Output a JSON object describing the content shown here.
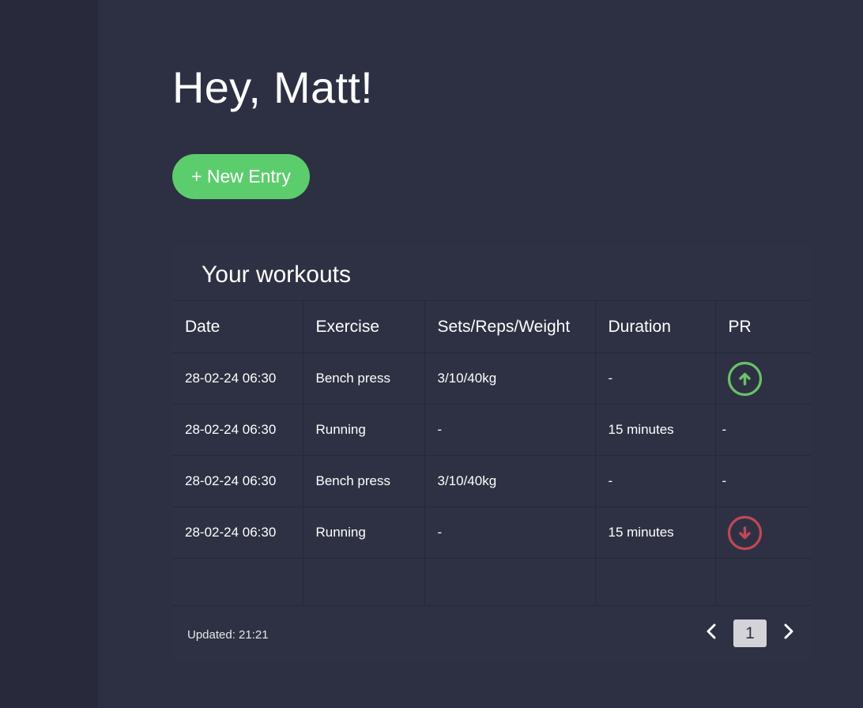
{
  "greeting": "Hey, Matt!",
  "new_entry_label": "+ New Entry",
  "workouts": {
    "title": "Your workouts",
    "columns": [
      "Date",
      "Exercise",
      "Sets/Reps/Weight",
      "Duration",
      "PR"
    ],
    "rows": [
      {
        "date": "28-02-24 06:30",
        "exercise": "Bench press",
        "srw": "3/10/40kg",
        "duration": "-",
        "pr": "up-icon"
      },
      {
        "date": "28-02-24 06:30",
        "exercise": "Running",
        "srw": "-",
        "duration": "15 minutes",
        "pr": "-"
      },
      {
        "date": "28-02-24 06:30",
        "exercise": "Bench press",
        "srw": "3/10/40kg",
        "duration": "-",
        "pr": "-"
      },
      {
        "date": "28-02-24 06:30",
        "exercise": "Running",
        "srw": "-",
        "duration": "15 minutes",
        "pr": "down-icon"
      }
    ],
    "updated": "Updated: 21:21",
    "page": "1"
  },
  "colors": {
    "accent": "#5ccd6d",
    "pr_up": "#6bc06a",
    "pr_down": "#c04856",
    "background": "#2d3042",
    "card": "#2e3143"
  },
  "icons": {
    "prev": "chevron-left-icon",
    "next": "chevron-right-icon",
    "pr_up": "arrow-up-circle-icon",
    "pr_down": "arrow-down-circle-icon"
  }
}
